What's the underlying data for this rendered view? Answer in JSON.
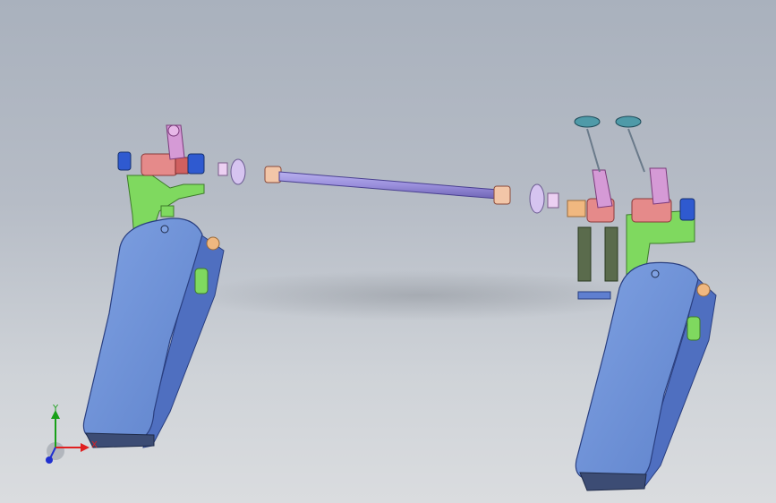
{
  "viewport": {
    "background_top": "#a9b1bd",
    "background_bottom": "#dadcdf"
  },
  "model": {
    "parts": {
      "pedal_plate": "#6f93d8",
      "frame": "#7fd95f",
      "hub_block": "#e58a8a",
      "drive_shaft": "#9a8fdc",
      "cam_arm": "#d59ad6",
      "beater_disc": "#4f9aa8",
      "spring": "#5a6b4c",
      "clamp_knob": "#f0b880",
      "mount_block": "#2f5ad0"
    }
  },
  "triad": {
    "x_label": "X",
    "y_label": "Y",
    "x_color": "#e02020",
    "y_color": "#18a018",
    "z_color": "#2030d0",
    "icon": "coordinate-triad-icon"
  }
}
